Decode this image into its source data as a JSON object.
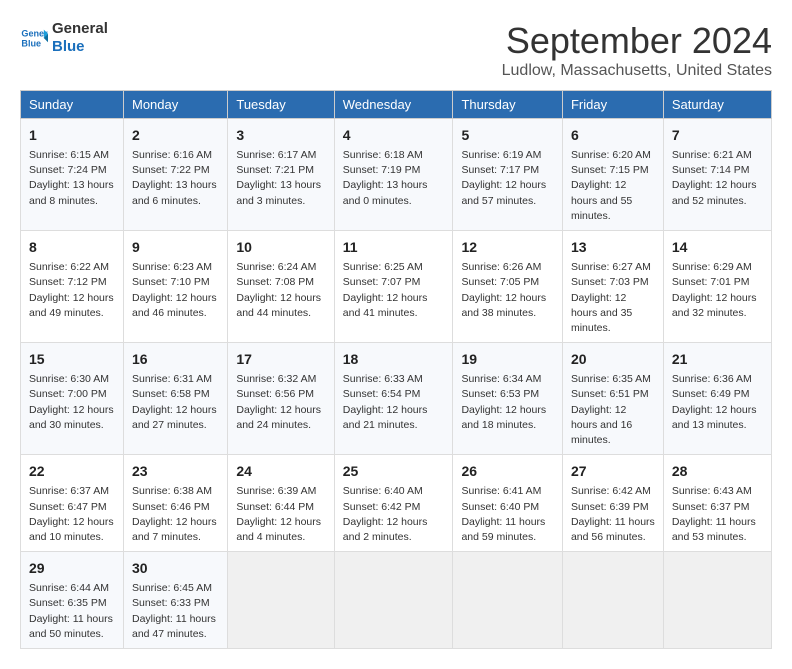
{
  "logo": {
    "line1": "General",
    "line2": "Blue"
  },
  "title": "September 2024",
  "location": "Ludlow, Massachusetts, United States",
  "headers": [
    "Sunday",
    "Monday",
    "Tuesday",
    "Wednesday",
    "Thursday",
    "Friday",
    "Saturday"
  ],
  "weeks": [
    [
      {
        "day": "1",
        "sunrise": "6:15 AM",
        "sunset": "7:24 PM",
        "daylight": "13 hours and 8 minutes."
      },
      {
        "day": "2",
        "sunrise": "6:16 AM",
        "sunset": "7:22 PM",
        "daylight": "13 hours and 6 minutes."
      },
      {
        "day": "3",
        "sunrise": "6:17 AM",
        "sunset": "7:21 PM",
        "daylight": "13 hours and 3 minutes."
      },
      {
        "day": "4",
        "sunrise": "6:18 AM",
        "sunset": "7:19 PM",
        "daylight": "13 hours and 0 minutes."
      },
      {
        "day": "5",
        "sunrise": "6:19 AM",
        "sunset": "7:17 PM",
        "daylight": "12 hours and 57 minutes."
      },
      {
        "day": "6",
        "sunrise": "6:20 AM",
        "sunset": "7:15 PM",
        "daylight": "12 hours and 55 minutes."
      },
      {
        "day": "7",
        "sunrise": "6:21 AM",
        "sunset": "7:14 PM",
        "daylight": "12 hours and 52 minutes."
      }
    ],
    [
      {
        "day": "8",
        "sunrise": "6:22 AM",
        "sunset": "7:12 PM",
        "daylight": "12 hours and 49 minutes."
      },
      {
        "day": "9",
        "sunrise": "6:23 AM",
        "sunset": "7:10 PM",
        "daylight": "12 hours and 46 minutes."
      },
      {
        "day": "10",
        "sunrise": "6:24 AM",
        "sunset": "7:08 PM",
        "daylight": "12 hours and 44 minutes."
      },
      {
        "day": "11",
        "sunrise": "6:25 AM",
        "sunset": "7:07 PM",
        "daylight": "12 hours and 41 minutes."
      },
      {
        "day": "12",
        "sunrise": "6:26 AM",
        "sunset": "7:05 PM",
        "daylight": "12 hours and 38 minutes."
      },
      {
        "day": "13",
        "sunrise": "6:27 AM",
        "sunset": "7:03 PM",
        "daylight": "12 hours and 35 minutes."
      },
      {
        "day": "14",
        "sunrise": "6:29 AM",
        "sunset": "7:01 PM",
        "daylight": "12 hours and 32 minutes."
      }
    ],
    [
      {
        "day": "15",
        "sunrise": "6:30 AM",
        "sunset": "7:00 PM",
        "daylight": "12 hours and 30 minutes."
      },
      {
        "day": "16",
        "sunrise": "6:31 AM",
        "sunset": "6:58 PM",
        "daylight": "12 hours and 27 minutes."
      },
      {
        "day": "17",
        "sunrise": "6:32 AM",
        "sunset": "6:56 PM",
        "daylight": "12 hours and 24 minutes."
      },
      {
        "day": "18",
        "sunrise": "6:33 AM",
        "sunset": "6:54 PM",
        "daylight": "12 hours and 21 minutes."
      },
      {
        "day": "19",
        "sunrise": "6:34 AM",
        "sunset": "6:53 PM",
        "daylight": "12 hours and 18 minutes."
      },
      {
        "day": "20",
        "sunrise": "6:35 AM",
        "sunset": "6:51 PM",
        "daylight": "12 hours and 16 minutes."
      },
      {
        "day": "21",
        "sunrise": "6:36 AM",
        "sunset": "6:49 PM",
        "daylight": "12 hours and 13 minutes."
      }
    ],
    [
      {
        "day": "22",
        "sunrise": "6:37 AM",
        "sunset": "6:47 PM",
        "daylight": "12 hours and 10 minutes."
      },
      {
        "day": "23",
        "sunrise": "6:38 AM",
        "sunset": "6:46 PM",
        "daylight": "12 hours and 7 minutes."
      },
      {
        "day": "24",
        "sunrise": "6:39 AM",
        "sunset": "6:44 PM",
        "daylight": "12 hours and 4 minutes."
      },
      {
        "day": "25",
        "sunrise": "6:40 AM",
        "sunset": "6:42 PM",
        "daylight": "12 hours and 2 minutes."
      },
      {
        "day": "26",
        "sunrise": "6:41 AM",
        "sunset": "6:40 PM",
        "daylight": "11 hours and 59 minutes."
      },
      {
        "day": "27",
        "sunrise": "6:42 AM",
        "sunset": "6:39 PM",
        "daylight": "11 hours and 56 minutes."
      },
      {
        "day": "28",
        "sunrise": "6:43 AM",
        "sunset": "6:37 PM",
        "daylight": "11 hours and 53 minutes."
      }
    ],
    [
      {
        "day": "29",
        "sunrise": "6:44 AM",
        "sunset": "6:35 PM",
        "daylight": "11 hours and 50 minutes."
      },
      {
        "day": "30",
        "sunrise": "6:45 AM",
        "sunset": "6:33 PM",
        "daylight": "11 hours and 47 minutes."
      },
      null,
      null,
      null,
      null,
      null
    ]
  ],
  "labels": {
    "sunrise": "Sunrise: ",
    "sunset": "Sunset: ",
    "daylight": "Daylight: "
  }
}
